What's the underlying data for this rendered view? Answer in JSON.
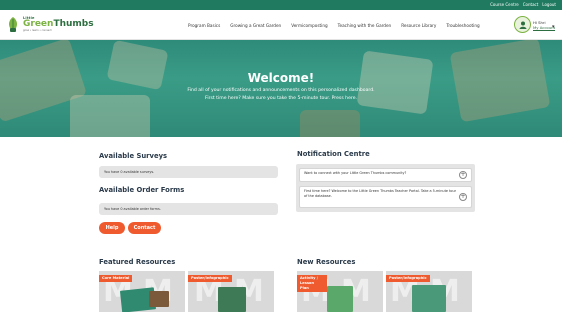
{
  "utility_bar": {
    "links": [
      "Course Centre",
      "Contact",
      "Logout"
    ]
  },
  "header": {
    "logo": {
      "small": "Little",
      "big_part1": "Green",
      "big_part2": "Thumbs",
      "tagline": "grow • learn • connect"
    },
    "nav": [
      "Program Basics",
      "Growing a Great Garden",
      "Vermicomposting",
      "Teaching with the Garden",
      "Resource Library",
      "Troubleshooting"
    ],
    "account": {
      "greeting": "Hi Shri",
      "link": "My Account"
    }
  },
  "hero": {
    "title": "Welcome!",
    "line1": "Find all of your notifications and announcements on this personalized dashboard.",
    "line2": "First time here? Make sure you take the 5-minute tour. Press here."
  },
  "surveys": {
    "title": "Available Surveys",
    "message": "You have 0 available surveys."
  },
  "order_forms": {
    "title": "Available Order Forms",
    "message": "You have 0 available order forms."
  },
  "actions": {
    "help": "Help",
    "contact": "Contact"
  },
  "notifications": {
    "title": "Notification Centre",
    "items": [
      "Want to connect with your Little Green Thumbs community?",
      "First time here? Welcome to the Little Green Thumbs Teacher Portal. Take a 5-minute tour of the database."
    ]
  },
  "featured": {
    "title": "Featured Resources",
    "cards": [
      {
        "tag": "Core Material"
      },
      {
        "tag": "Poster/Infographic"
      }
    ]
  },
  "new_resources": {
    "title": "New Resources",
    "cards": [
      {
        "tag": "Activity / Lesson Plan"
      },
      {
        "tag": "Poster/Infographic"
      }
    ]
  },
  "colors": {
    "brand_green": "#1f7a5f",
    "accent_orange": "#ef5a2f",
    "hero_teal": "#3a9c86"
  }
}
